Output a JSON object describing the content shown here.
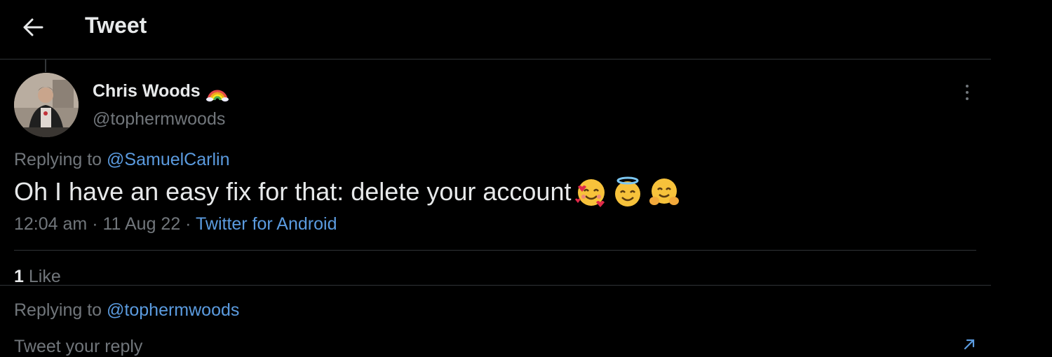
{
  "header": {
    "title": "Tweet",
    "back_icon": "arrow-left-icon"
  },
  "tweet": {
    "author_name": "Chris Woods",
    "author_badge_emoji": "rainbow",
    "author_handle": "@tophermwoods",
    "replying_label": "Replying to ",
    "replying_to": "@SamuelCarlin",
    "text": "Oh I have an easy fix for that: delete your account",
    "emojis": [
      "smiling-face-with-hearts",
      "smiling-face-with-halo",
      "hugging-face"
    ],
    "time": "12:04 am",
    "date": "11 Aug 22",
    "source": "Twitter for Android",
    "like_count": "1",
    "like_label": "Like"
  },
  "composer": {
    "replying_label": "Replying to ",
    "replying_to": "@tophermwoods",
    "placeholder": "Tweet your reply"
  },
  "colors": {
    "background": "#000000",
    "text": "#e7e9ea",
    "muted": "#71767b",
    "link": "#5b9bdf",
    "divider": "#2f3336"
  }
}
